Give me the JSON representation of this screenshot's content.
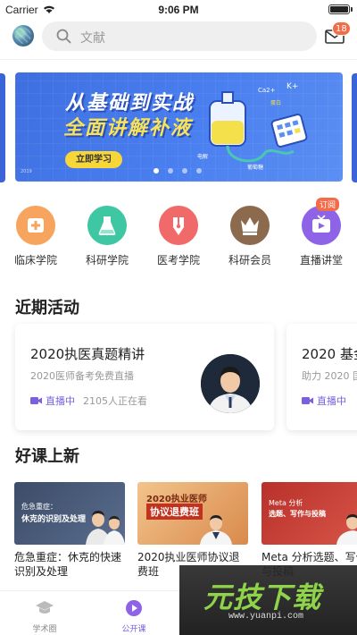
{
  "status_bar": {
    "carrier": "Carrier",
    "time": "9:06 PM"
  },
  "header": {
    "search_placeholder": "文献",
    "mail_badge": "18"
  },
  "banner": {
    "title_line1": "从基础到实战",
    "title_line2": "全面讲解补液",
    "button_label": "立即学习",
    "year": "2019",
    "page_count": 4,
    "active_page": 0
  },
  "categories": [
    {
      "label": "临床学院",
      "icon": "plus-icon",
      "color": "#f5a05a"
    },
    {
      "label": "科研学院",
      "icon": "flask-icon",
      "color": "#3fc2a0"
    },
    {
      "label": "医考学院",
      "icon": "pen-icon",
      "color": "#f06a6a"
    },
    {
      "label": "科研会员",
      "icon": "crown-icon",
      "color": "#8b6a4e"
    },
    {
      "label": "直播讲堂",
      "icon": "tv-icon",
      "color": "#8e63e6",
      "badge": "订阅"
    }
  ],
  "sections": {
    "activities_title": "近期活动",
    "new_courses_title": "好课上新"
  },
  "activities": [
    {
      "title": "2020执医真题精讲",
      "subtitle": "2020医师备考免费直播",
      "live_label": "直播中",
      "viewers": "2105人正在看"
    },
    {
      "title": "2020 基金",
      "subtitle": "助力 2020 国",
      "live_label": "直播中",
      "viewers": ""
    }
  ],
  "courses": [
    {
      "title": "危急重症：休克的快速识别及处理",
      "thumb_line1": "危急重症：",
      "thumb_line2": "休克的识别及处理",
      "color": "#4b5d7a"
    },
    {
      "title": "2020执业医师协议退费班",
      "thumb_line1": "2020执业医师",
      "thumb_line2": "协议退费班",
      "color": "#d88a4a"
    },
    {
      "title": "Meta 分析选题、写作与投稿",
      "thumb_line1": "Meta 分析",
      "thumb_line2": "选题、写作与投稿",
      "color": "#c8423a"
    }
  ],
  "tabbar": {
    "tabs": [
      {
        "label": "学术圈",
        "icon": "mortarboard-icon"
      },
      {
        "label": "公开课",
        "icon": "play-icon",
        "active": true
      },
      {
        "label": "",
        "icon": "hidden-icon"
      },
      {
        "label": "",
        "icon": "hidden-icon"
      }
    ]
  },
  "watermark": {
    "logo": "元技下载",
    "url": "www.yuanpi.com"
  }
}
